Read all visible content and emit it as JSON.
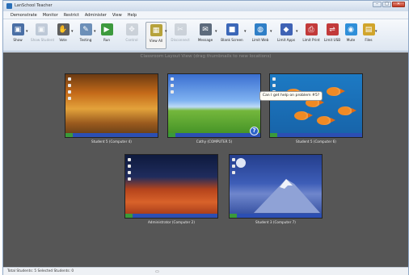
{
  "window": {
    "title": "LanSchool Teacher",
    "controls": [
      "–",
      "□",
      "✕"
    ]
  },
  "menu": [
    "Demonstrate",
    "Monitor",
    "Restrict",
    "Administer",
    "View",
    "Help"
  ],
  "toolbar": {
    "buttons": [
      {
        "label": "Show",
        "icon": "show-icon",
        "color": "#4a6fa5",
        "glyph": "▣",
        "dim": false,
        "dropdown": true
      },
      {
        "label": "Show Student",
        "icon": "show-student-icon",
        "color": "#7a8fa8",
        "glyph": "▣",
        "dim": true,
        "dropdown": false
      },
      {
        "label": "Vote",
        "icon": "vote-icon",
        "color": "#5e5e5e",
        "glyph": "✋",
        "dim": false,
        "dropdown": true
      },
      {
        "label": "Testing",
        "icon": "testing-icon",
        "color": "#6c8fb8",
        "glyph": "✎",
        "dim": false,
        "dropdown": true
      },
      {
        "label": "Run",
        "icon": "run-icon",
        "color": "#3d9a3d",
        "glyph": "▶",
        "dim": false,
        "dropdown": false
      },
      {
        "label": "Control",
        "icon": "control-icon",
        "color": "#9aa3ad",
        "glyph": "✥",
        "dim": true,
        "dropdown": false
      },
      {
        "label": "View All",
        "icon": "view-all-icon",
        "color": "#b6a23a",
        "glyph": "▦",
        "dim": false,
        "dropdown": true,
        "active": true
      },
      {
        "label": "Disconnect",
        "icon": "disconnect-icon",
        "color": "#9aa3ad",
        "glyph": "✂",
        "dim": true,
        "dropdown": false
      },
      {
        "label": "Message",
        "icon": "message-icon",
        "color": "#5d6b7c",
        "glyph": "✉",
        "dim": false,
        "dropdown": true
      },
      {
        "label": "Blank Screen",
        "icon": "blank-screen-icon",
        "color": "#3b67b8",
        "glyph": "■",
        "dim": false,
        "dropdown": true
      },
      {
        "label": "Limit Web",
        "icon": "limit-web-icon",
        "color": "#2f7fc7",
        "glyph": "◍",
        "dim": false,
        "dropdown": true
      },
      {
        "label": "Limit Apps",
        "icon": "limit-apps-icon",
        "color": "#3f63b5",
        "glyph": "◆",
        "dim": false,
        "dropdown": true
      },
      {
        "label": "Limit Print",
        "icon": "limit-print-icon",
        "color": "#c23a3a",
        "glyph": "⎙",
        "dim": false,
        "dropdown": false
      },
      {
        "label": "Limit USB",
        "icon": "limit-usb-icon",
        "color": "#c23a3a",
        "glyph": "⇌",
        "dim": false,
        "dropdown": false
      },
      {
        "label": "Mute",
        "icon": "mute-icon",
        "color": "#2f8fd9",
        "glyph": "◉",
        "dim": false,
        "dropdown": false
      },
      {
        "label": "Files",
        "icon": "files-icon",
        "color": "#d1a52c",
        "glyph": "▤",
        "dim": false,
        "dropdown": true
      }
    ]
  },
  "main": {
    "hint": "Classroom Layout View (drag thumbnails to new locations)",
    "thumbnails": [
      {
        "caption": "Student 5 (Computer 4)",
        "wallpaper": "autumn"
      },
      {
        "caption": "Cathy (COMPUTER 5)",
        "wallpaper": "xp",
        "help_badge": "?"
      },
      {
        "caption": "Student 5 (Computer 6)",
        "wallpaper": "fish"
      },
      {
        "caption": "Administrator (Computer 2)",
        "wallpaper": "desert"
      },
      {
        "caption": "Student 3 (Computer 7)",
        "wallpaper": "mountain"
      }
    ],
    "help_bubble": "Can I get help on problem #5?"
  },
  "status": {
    "text": "Total Students: 5  Selected Students: 0",
    "icon": "monitor-icon"
  }
}
